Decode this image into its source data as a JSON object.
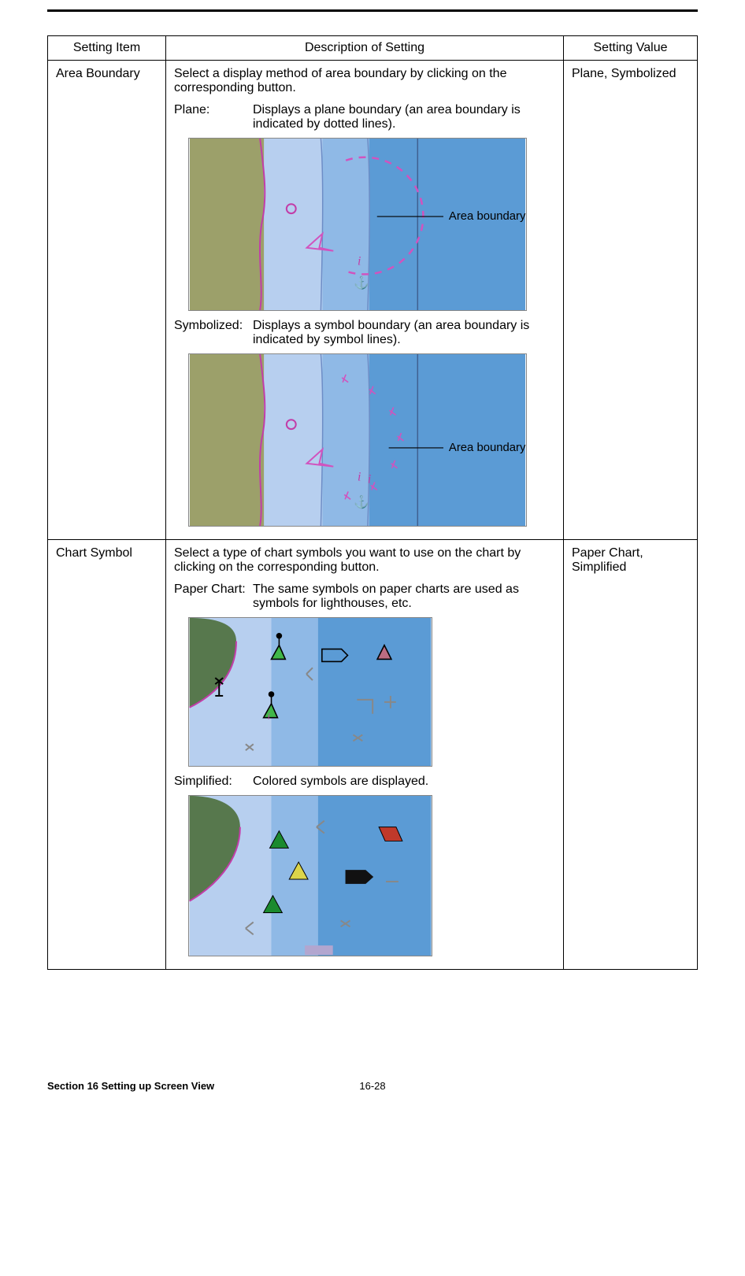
{
  "headers": {
    "item": "Setting Item",
    "desc": "Description of Setting",
    "value": "Setting Value"
  },
  "rows": [
    {
      "item": "Area Boundary",
      "intro": "Select a display method of area boundary by clicking on the corresponding button.",
      "opt1_label": "Plane:",
      "opt1_desc": "Displays a plane boundary (an area boundary is indicated by dotted lines).",
      "opt1_callout": "Area boundary",
      "opt2_label": "Symbolized:",
      "opt2_desc": "Displays a symbol boundary (an area boundary is indicated by symbol lines).",
      "opt2_callout": "Area boundary",
      "value": "Plane, Symbolized"
    },
    {
      "item": "Chart Symbol",
      "intro": "Select a type of chart symbols you want to use on the chart by clicking on the corresponding button.",
      "opt1_label": "Paper Chart:",
      "opt1_desc": "The same symbols on paper charts are used as symbols for lighthouses, etc.",
      "opt2_label": "Simplified:",
      "opt2_desc": "Colored symbols are displayed.",
      "value": "Paper Chart, Simplified"
    }
  ],
  "footer": {
    "section": "Section 16    Setting up Screen View",
    "page": "16-28"
  },
  "info_glyph": "i",
  "anchor_glyph": "⚓"
}
